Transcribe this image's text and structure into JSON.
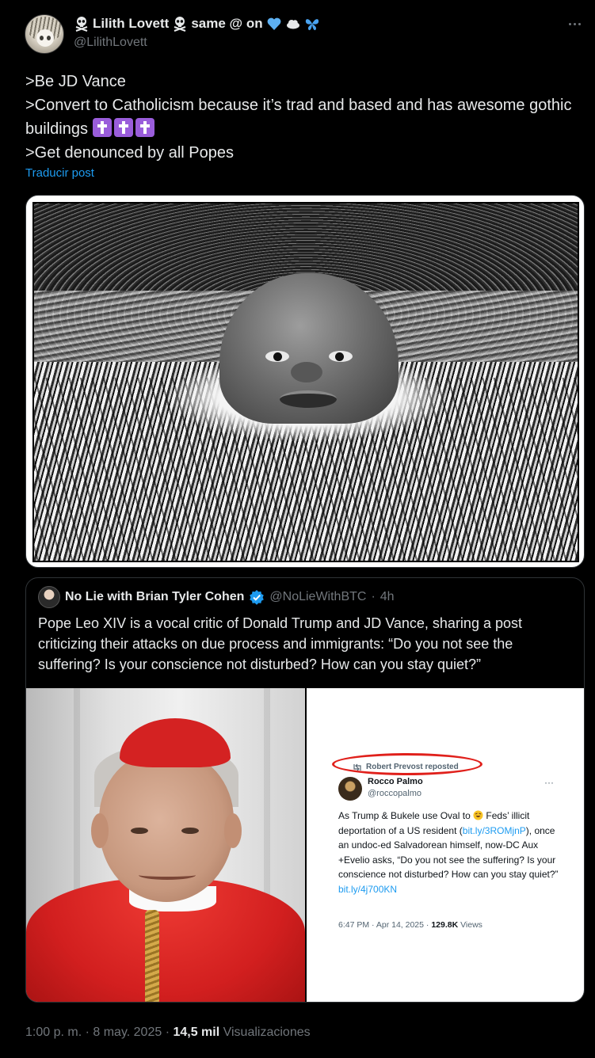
{
  "author": {
    "display_name": "Lilith Lovett",
    "display_suffix": "same @ on",
    "handle": "@LilithLovett",
    "icons": [
      "skull-crossbones-icon",
      "skull-crossbones-icon",
      "blue-heart-icon",
      "cloud-icon",
      "butterfly-icon"
    ]
  },
  "tweet": {
    "lines": [
      ">Be JD Vance",
      ">Convert to Catholicism because it’s trad and based and has awesome gothic buildings",
      ">Get denounced by all Popes"
    ],
    "cross_emoji_count": 3,
    "translate_label": "Traducir post"
  },
  "quoted": {
    "name": "No Lie with Brian Tyler Cohen",
    "handle": "@NoLieWithBTC",
    "separator": "·",
    "time": "4h",
    "text": "Pope Leo XIV is a vocal critic of Donald Trump and JD Vance, sharing a post criticizing their attacks on due process and immigrants: “Do you not see the suffering? Is your conscience not disturbed? How can you stay quiet?”",
    "screenshot": {
      "repost_label": "Robert Prevost reposted",
      "name": "Rocco Palmo",
      "handle": "@roccopalmo",
      "more": "···",
      "text_1": "As Trump & Bukele use Oval to",
      "text_2": " Feds’ illicit deportation of a US resident (",
      "link_1": "bit.ly/3ROMjnP",
      "text_3": "), once an undoc-ed Salvadorean himself, now-DC Aux +Evelio asks, “Do you not see the suffering? Is your conscience not disturbed? How can you stay quiet?” ",
      "link_2": "bit.ly/4j700KN",
      "meta_time": "6:47 PM · Apr 14, 2025 · ",
      "meta_views": "129.8K",
      "meta_views_label": " Views"
    }
  },
  "footer": {
    "time": "1:00 p. m.",
    "sep1": " · ",
    "date": "8 may. 2025",
    "sep2": " · ",
    "views": "14,5 mil",
    "views_label": " Visualizaciones"
  },
  "colors": {
    "background": "#000000",
    "text": "#e7e9ea",
    "muted": "#71767b",
    "link": "#1d9bf0",
    "border": "#2f3336",
    "cross_emoji": "#9a5ddb",
    "oval": "#e0201b"
  }
}
